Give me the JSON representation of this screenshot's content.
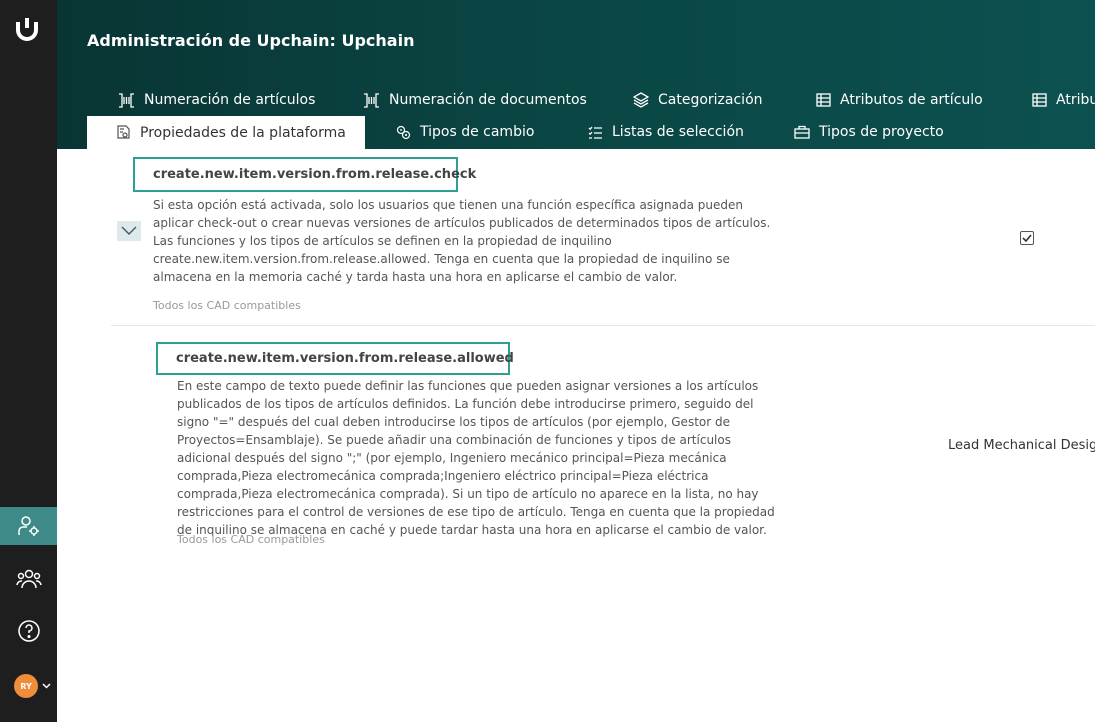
{
  "header": {
    "title": "Administración de Upchain: Upchain"
  },
  "tabs_row1": [
    {
      "label": "Numeración de artículos",
      "icon": "item-numbering-icon"
    },
    {
      "label": "Numeración de documentos",
      "icon": "document-numbering-icon"
    },
    {
      "label": "Categorización",
      "icon": "layers-icon"
    },
    {
      "label": "Atributos de artículo",
      "icon": "table-icon"
    },
    {
      "label": "Atribu",
      "icon": "table-settings-icon"
    }
  ],
  "tabs_row2": [
    {
      "label": "Propiedades de la plataforma",
      "icon": "platform-properties-icon",
      "active": true
    },
    {
      "label": "Tipos de cambio",
      "icon": "change-types-icon"
    },
    {
      "label": "Listas de selección",
      "icon": "list-icon"
    },
    {
      "label": "Tipos de proyecto",
      "icon": "briefcase-icon"
    }
  ],
  "properties": [
    {
      "key": "create.new.item.version.from.release.check",
      "description": "Si esta opción está activada, solo los usuarios que tienen una función específica asignada pueden aplicar check-out o crear nuevas versiones de artículos publicados de determinados tipos de artículos. Las funciones y los tipos de artículos se definen en la propiedad de inquilino create.new.item.version.from.release.allowed. Tenga en cuenta que la propiedad de inquilino se almacena en la memoria caché y tarda hasta una hora en aplicarse el cambio de valor.",
      "note": "Todos los CAD compatibles",
      "checked": true
    },
    {
      "key": "create.new.item.version.from.release.allowed",
      "description": "En este campo de texto puede definir las funciones que pueden asignar versiones a los artículos publicados de los tipos de artículos definidos. La función debe introducirse primero, seguido del signo \"=\" después del cual deben introducirse los tipos de artículos (por ejemplo, Gestor de Proyectos=Ensamblaje). Se puede añadir una combinación de funciones y tipos de artículos adicional después del signo \";\" (por ejemplo, Ingeniero mecánico principal=Pieza mecánica comprada,Pieza electromecánica comprada;Ingeniero eléctrico principal=Pieza eléctrica comprada,Pieza electromecánica comprada). Si un tipo de artículo no aparece en la lista, no hay restricciones para el control de versiones de ese tipo de artículo. Tenga en cuenta que la propiedad de inquilino se almacena en caché y puede tardar hasta una hora en aplicarse el cambio de valor.",
      "note": "Todos los CAD compatibles",
      "value": "Lead Mechanical Design"
    }
  ],
  "sidebar": {
    "items": [
      {
        "icon": "admin-settings-icon",
        "active": true
      },
      {
        "icon": "users-icon"
      },
      {
        "icon": "help-icon"
      }
    ],
    "avatar_initials": "RY"
  },
  "colors": {
    "header": "#0a4543",
    "accent": "#2aa191",
    "active_sidebar": "#3e8a88",
    "sidebar": "#1e1e1e"
  }
}
